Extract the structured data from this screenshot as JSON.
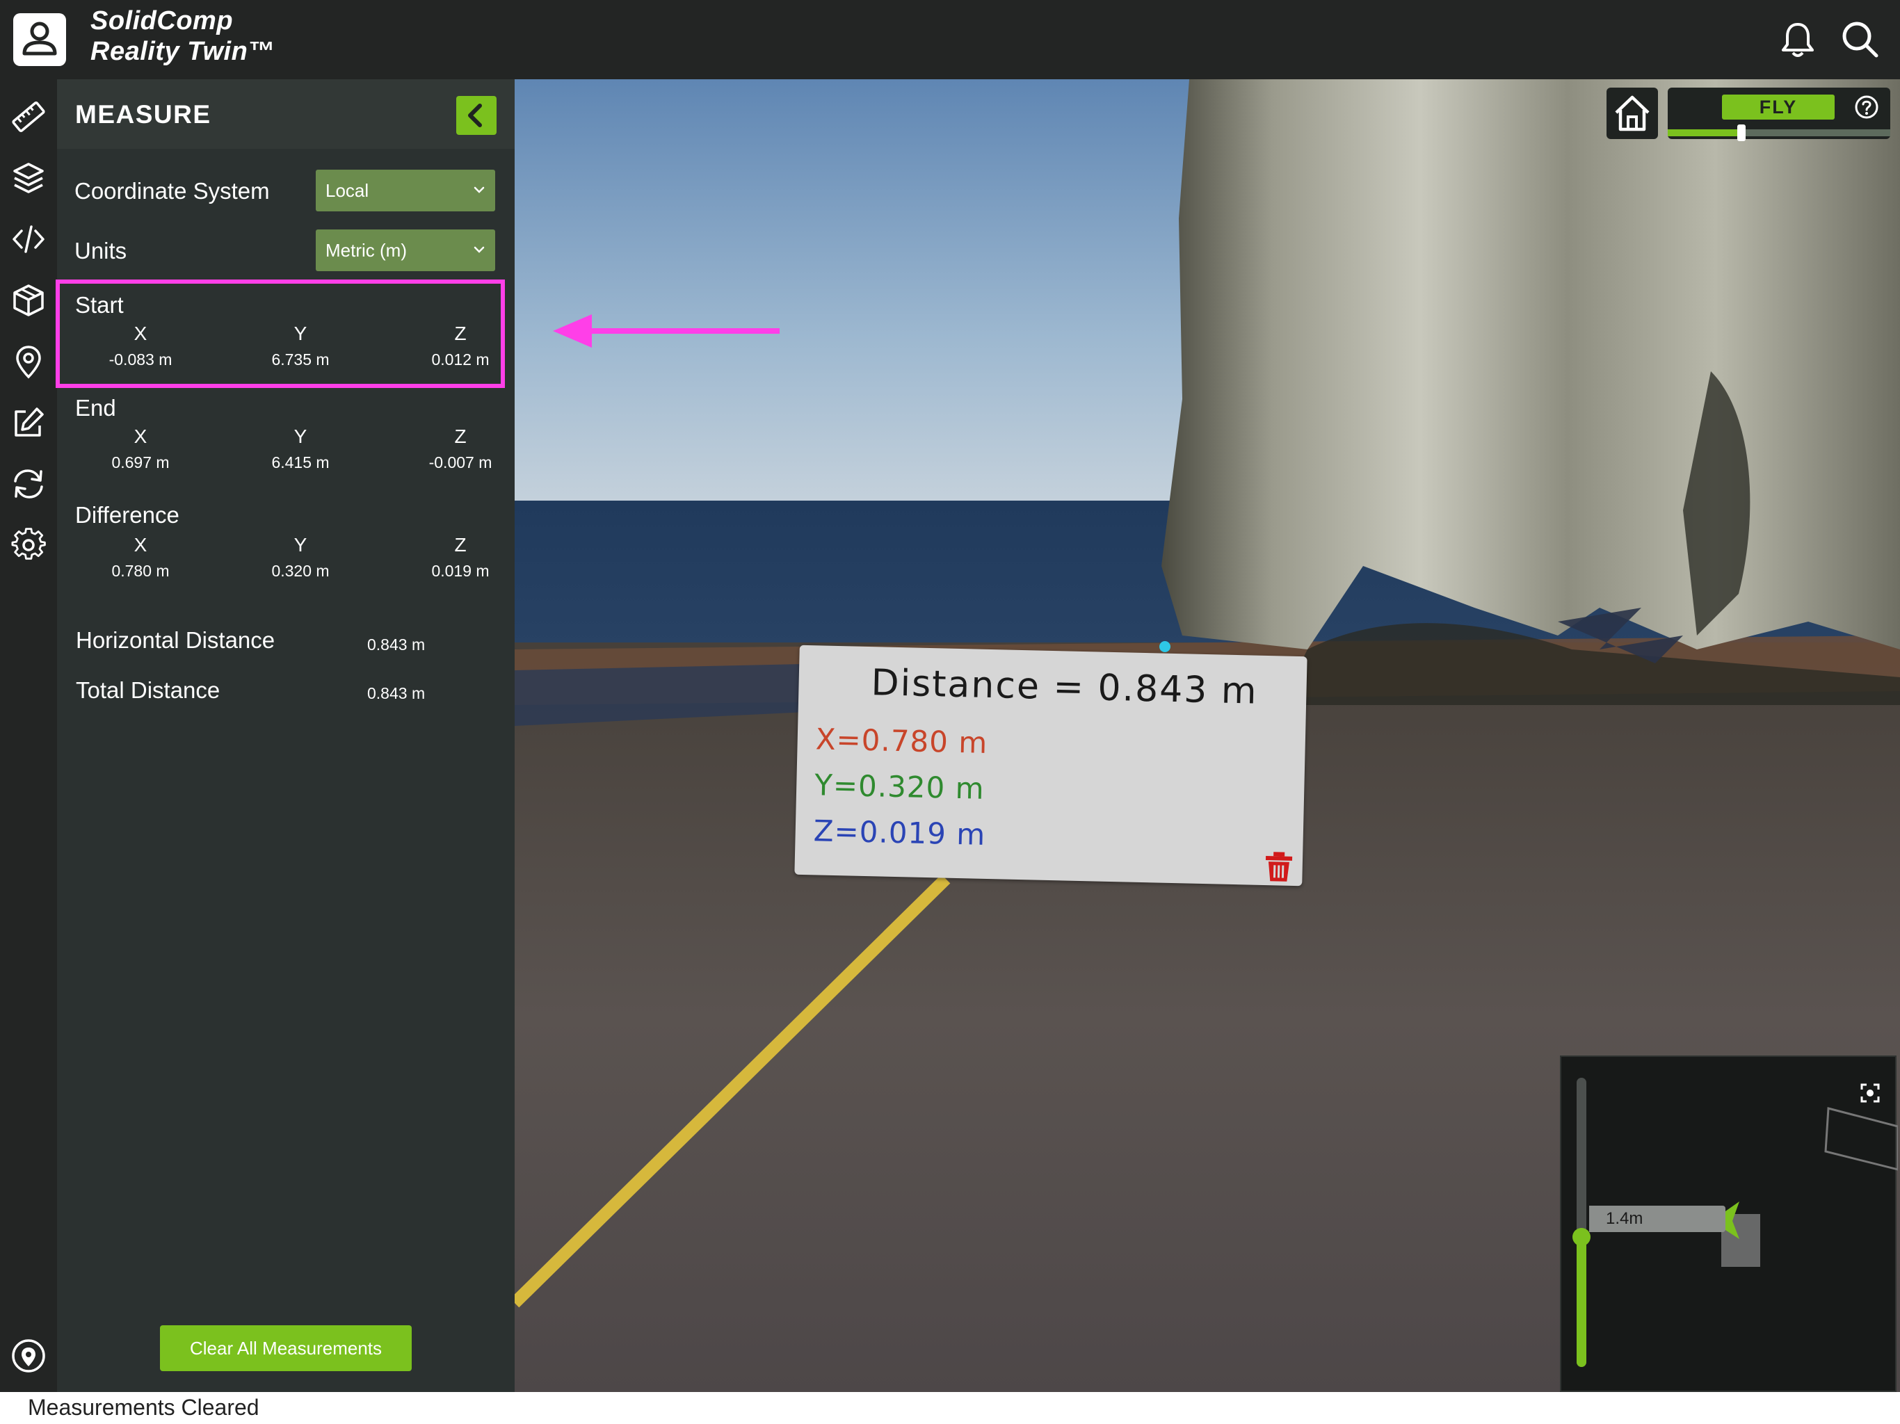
{
  "app": {
    "brand_line1": "SolidComp",
    "brand_line2": "Reality Twin™"
  },
  "topbar": {
    "icons": [
      "user-icon",
      "bell-icon",
      "search-icon"
    ]
  },
  "rail": {
    "icons": [
      "ruler-icon",
      "layers-icon",
      "code-icon",
      "cube-icon",
      "location-pin-icon",
      "edit-icon",
      "sync-icon",
      "gear-icon",
      "location-icon"
    ]
  },
  "panel": {
    "title": "MEASURE",
    "coordinate_system_label": "Coordinate System",
    "coordinate_system_value": "Local",
    "units_label": "Units",
    "units_value": "Metric (m)",
    "start": {
      "title": "Start",
      "x_label": "X",
      "y_label": "Y",
      "z_label": "Z",
      "x": "-0.083 m",
      "y": "6.735 m",
      "z": "0.012 m"
    },
    "end": {
      "title": "End",
      "x_label": "X",
      "y_label": "Y",
      "z_label": "Z",
      "x": "0.697 m",
      "y": "6.415 m",
      "z": "-0.007 m"
    },
    "difference": {
      "title": "Difference",
      "x_label": "X",
      "y_label": "Y",
      "z_label": "Z",
      "x": "0.780 m",
      "y": "0.320 m",
      "z": "0.019 m"
    },
    "horizontal_distance_label": "Horizontal Distance",
    "horizontal_distance_value": "0.843 m",
    "total_distance_label": "Total Distance",
    "total_distance_value": "0.843 m",
    "clear_button": "Clear All Measurements"
  },
  "status": {
    "message": "Measurements Cleared"
  },
  "viewer": {
    "fly_label": "FLY",
    "fly_speed": 0.33,
    "distance_card": {
      "title": "Distance = 0.843 m",
      "x_line": "X=0.780 m",
      "y_line": "Y=0.320 m",
      "z_line": "Z=0.019 m"
    },
    "minimap": {
      "scale_label": "1.4m",
      "zoom_level": 0.45
    }
  },
  "colors": {
    "accent": "#7bc11e",
    "panel_bg": "#2b3130",
    "bar_bg": "#232524",
    "highlight": "#ff3fe8",
    "x_color": "#c8452a",
    "y_color": "#2f8a2f",
    "z_color": "#2a44b5",
    "trash": "#d11a1a"
  }
}
